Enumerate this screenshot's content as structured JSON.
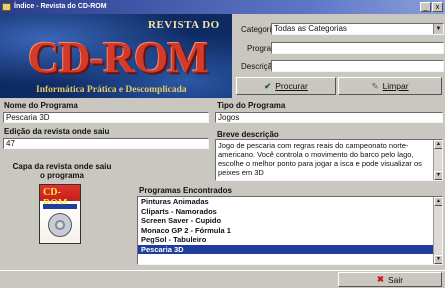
{
  "window": {
    "title": "Índice - Revista do CD-ROM",
    "minimize": "_",
    "close": "x"
  },
  "logo": {
    "top": "REVISTA DO",
    "main": "CD-ROM",
    "tagline": "Informática Prática e Descomplicada"
  },
  "search": {
    "categoria_label": "Categoria",
    "categoria_value": "Todas as Categorias",
    "programa_label": "Programa",
    "programa_value": "",
    "descricao_label": "Descrição",
    "descricao_value": ""
  },
  "buttons": {
    "procurar": "Procurar",
    "limpar": "Limpar",
    "sair": "Sair"
  },
  "detail": {
    "nome_label": "Nome do Programa",
    "nome_value": "Pescaria 3D",
    "tipo_label": "Tipo do Programa",
    "tipo_value": "Jogos",
    "edicao_label": "Edição da revista onde saiu",
    "edicao_value": "47",
    "descricao_label": "Breve descrição",
    "descricao_value": "Jogo de pescaria com regras reais do campeonato norte-americano. Você controla o movimento do barco pelo lago, escolhe o melhor ponto para jogar a isca e pode visualizar os peixes em 3D",
    "capa_label": "Capa da revista onde saiu o programa"
  },
  "cover": {
    "title": "CD-ROM"
  },
  "programs": {
    "label": "Programas Encontrados",
    "items": [
      "Pinturas Animadas",
      "Cliparts - Namorados",
      "Screen Saver - Cupido",
      "Monaco GP 2 - Fórmula 1",
      "PegSol - Tabuleiro",
      "Pescaria 3D"
    ],
    "selected_index": 5
  },
  "colors": {
    "selection": "#1f3d9a",
    "logo_red": "#d33a2a",
    "panel": "#c9c7bf"
  }
}
